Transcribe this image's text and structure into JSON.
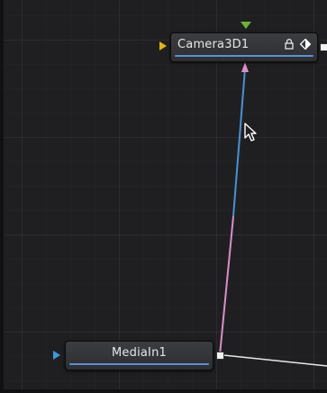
{
  "nodes": {
    "camera": {
      "title": "Camera3D1",
      "icons": [
        "lock-icon",
        "diamond-icon"
      ]
    },
    "media": {
      "title": "MediaIn1"
    }
  },
  "colors": {
    "background": "#1f1f21",
    "node_fill": "#35363a",
    "progress_bar": "#5d8fd0",
    "wire_blue": "#4a8fd6",
    "wire_pink": "#d98fc9",
    "wire_white": "#e8e8e8",
    "input_yellow": "#e2b21a",
    "input_blue": "#3f9ad6",
    "top_arrow_green": "#6fb03a"
  }
}
